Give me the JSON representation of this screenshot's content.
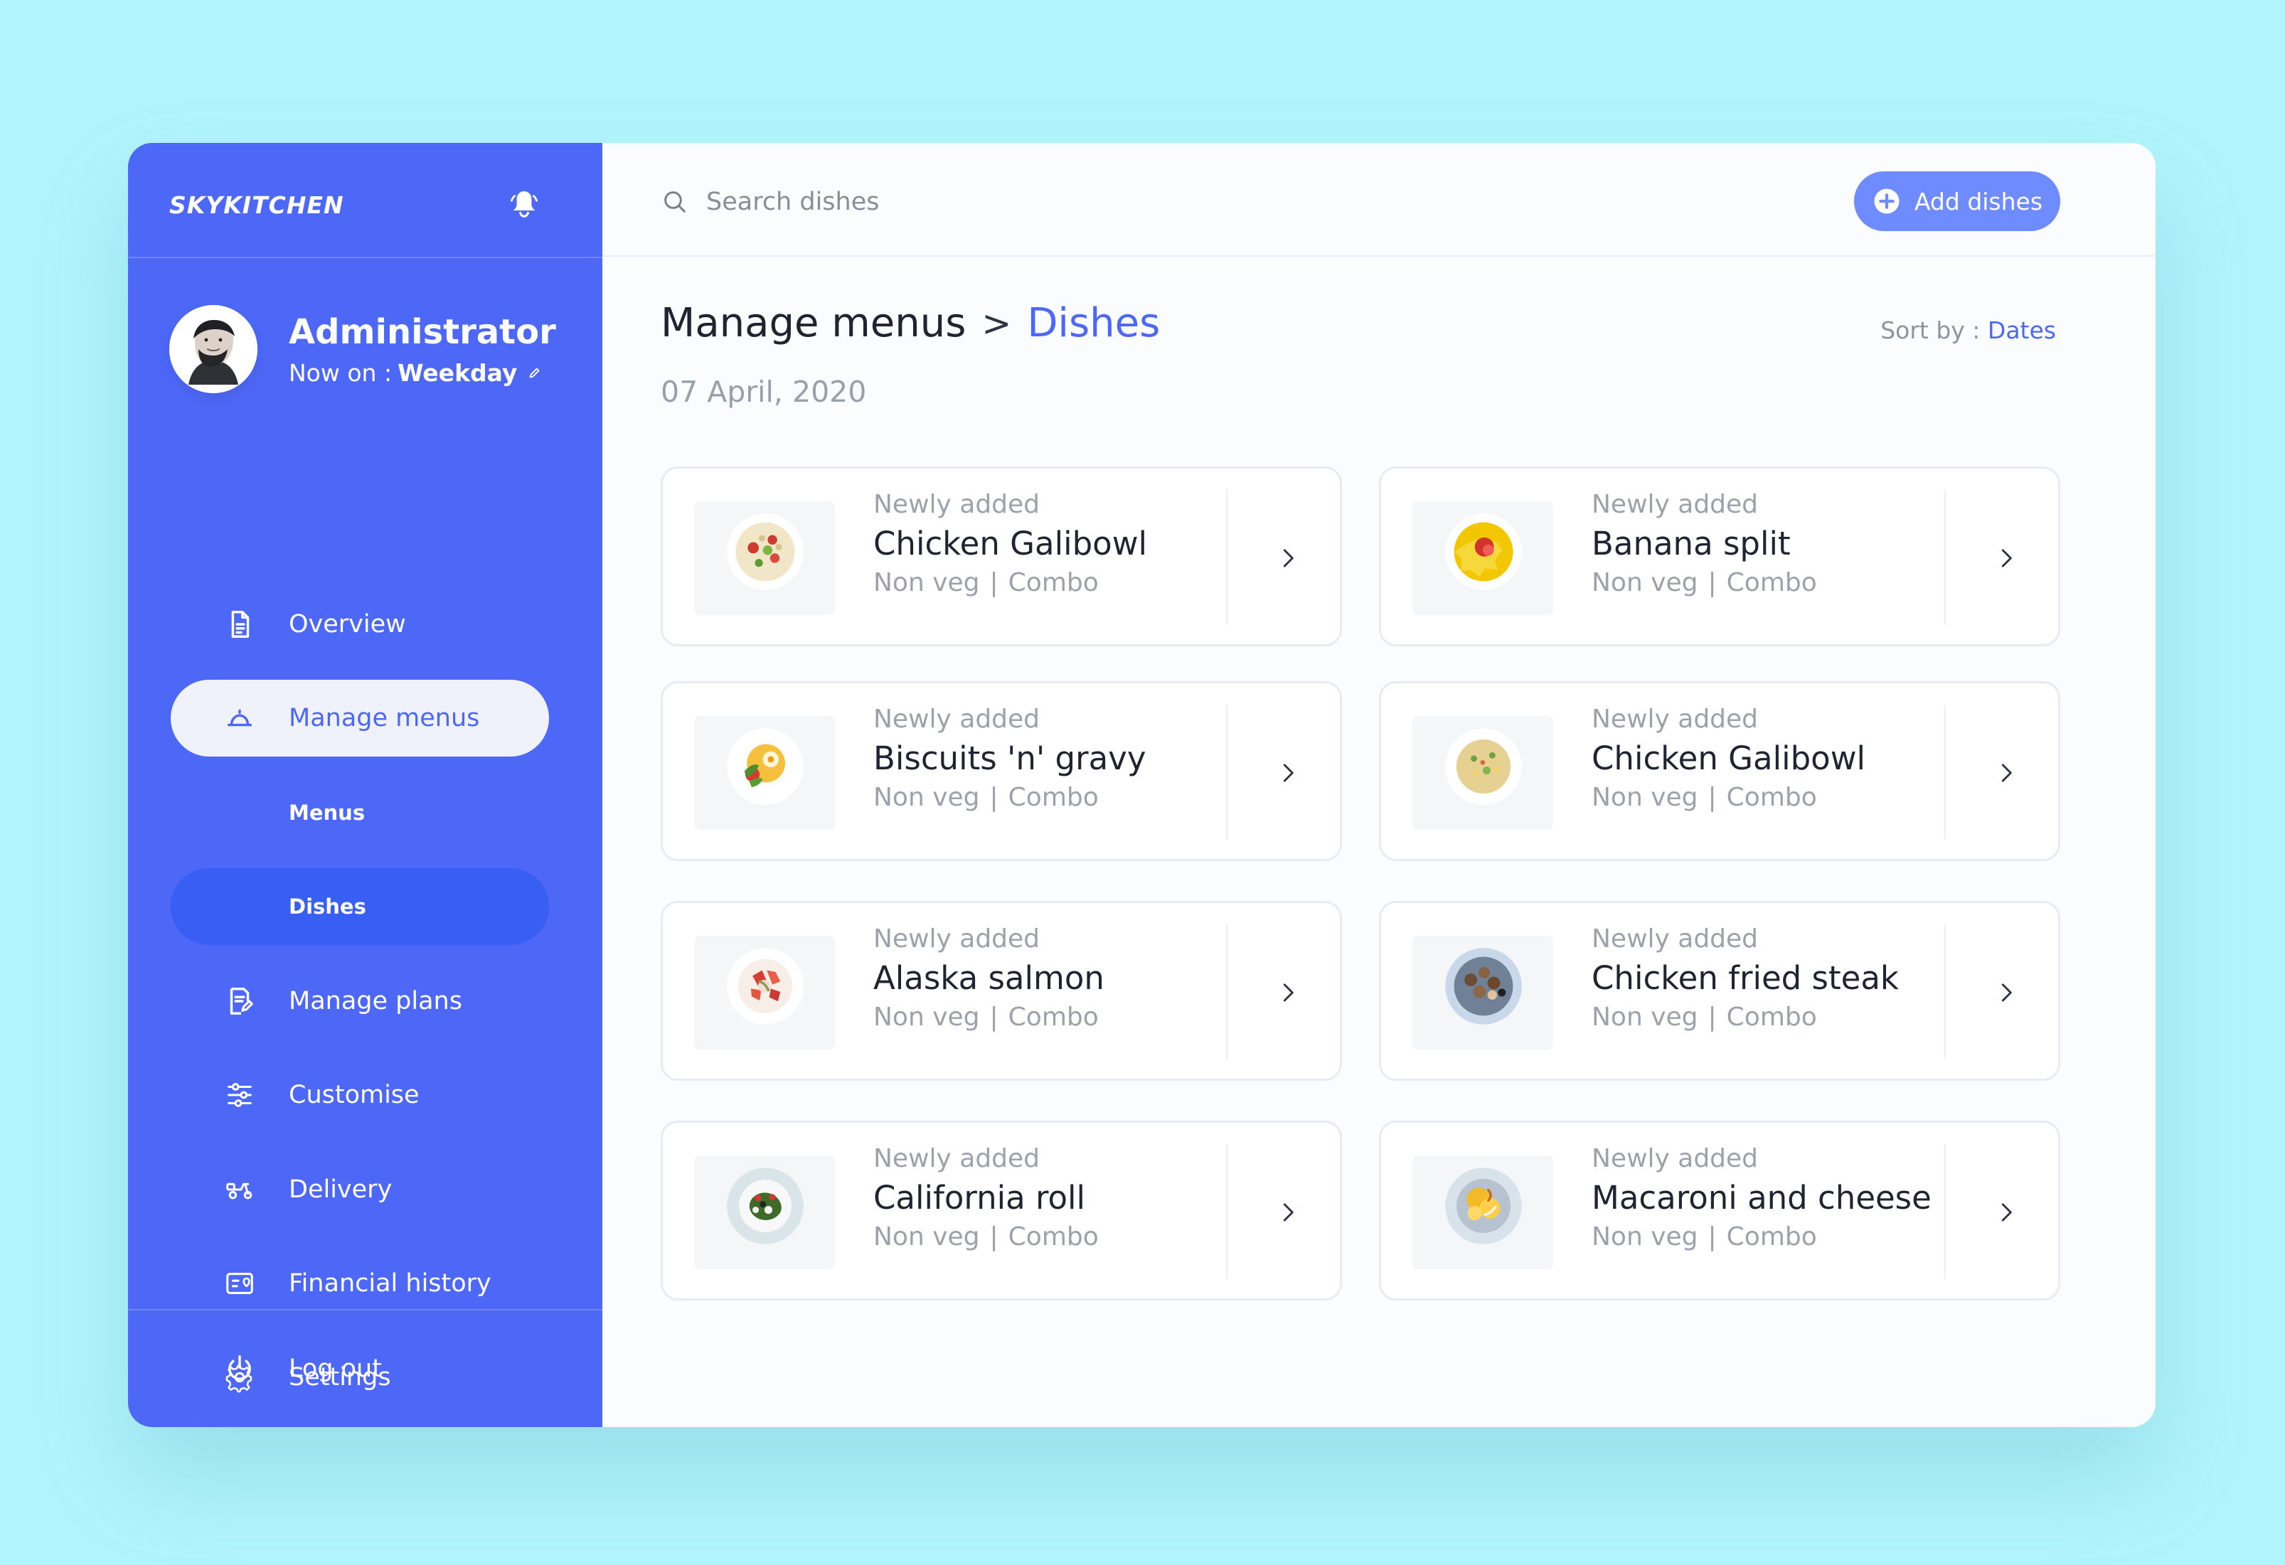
{
  "colors": {
    "page_background": "#b2f4fd",
    "sidebar": "#4d68f6",
    "sidebar_active_subitem": "#385ef4",
    "main_background": "#fbfcfe",
    "accent": "#4d68f6",
    "button": "#6e8cff",
    "text_dark": "#1f2430",
    "text_muted": "#9da1a9"
  },
  "sidebar": {
    "brand": "SKYKITCHEN",
    "profile": {
      "name": "Administrator",
      "status_label": "Now on :",
      "status_value": "Weekday"
    },
    "items": [
      {
        "label": "Overview",
        "icon": "document-icon"
      },
      {
        "label": "Manage menus",
        "icon": "cloche-icon"
      },
      {
        "label": "Manage plans",
        "icon": "plan-edit-icon"
      },
      {
        "label": "Customise",
        "icon": "sliders-icon"
      },
      {
        "label": "Delivery",
        "icon": "scooter-icon"
      },
      {
        "label": "Financial history",
        "icon": "finance-icon"
      },
      {
        "label": "Settings",
        "icon": "gear-icon"
      }
    ],
    "subitems": [
      {
        "label": "Menus"
      },
      {
        "label": "Dishes"
      }
    ],
    "logout": {
      "label": "Log out",
      "icon": "power-icon"
    }
  },
  "topbar": {
    "search_placeholder": "Search dishes",
    "add_button_label": "Add dishes"
  },
  "page": {
    "breadcrumb_parent": "Manage menus",
    "breadcrumb_separator": ">",
    "breadcrumb_current": "Dishes",
    "date": "07 April, 2020",
    "sort_label": "Sort by :",
    "sort_value": "Dates"
  },
  "dishes": [
    {
      "tag": "Newly added",
      "name": "Chicken Galibowl",
      "type": "Non veg",
      "category": "Combo",
      "image": "pasta-salad-image"
    },
    {
      "tag": "Newly added",
      "name": "Banana split",
      "type": "Non veg",
      "category": "Combo",
      "image": "fries-image"
    },
    {
      "tag": "Newly added",
      "name": "Biscuits 'n' gravy",
      "type": "Non veg",
      "category": "Combo",
      "image": "breakfast-plate-image"
    },
    {
      "tag": "Newly added",
      "name": "Chicken Galibowl",
      "type": "Non veg",
      "category": "Combo",
      "image": "rice-bowl-image"
    },
    {
      "tag": "Newly added",
      "name": "Alaska salmon",
      "type": "Non veg",
      "category": "Combo",
      "image": "salmon-plate-image"
    },
    {
      "tag": "Newly added",
      "name": "Chicken fried steak",
      "type": "Non veg",
      "category": "Combo",
      "image": "steak-plate-image"
    },
    {
      "tag": "Newly added",
      "name": "California roll",
      "type": "Non veg",
      "category": "Combo",
      "image": "roll-salad-image"
    },
    {
      "tag": "Newly added",
      "name": "Macaroni and cheese",
      "type": "Non veg",
      "category": "Combo",
      "image": "mac-cheese-image"
    }
  ]
}
